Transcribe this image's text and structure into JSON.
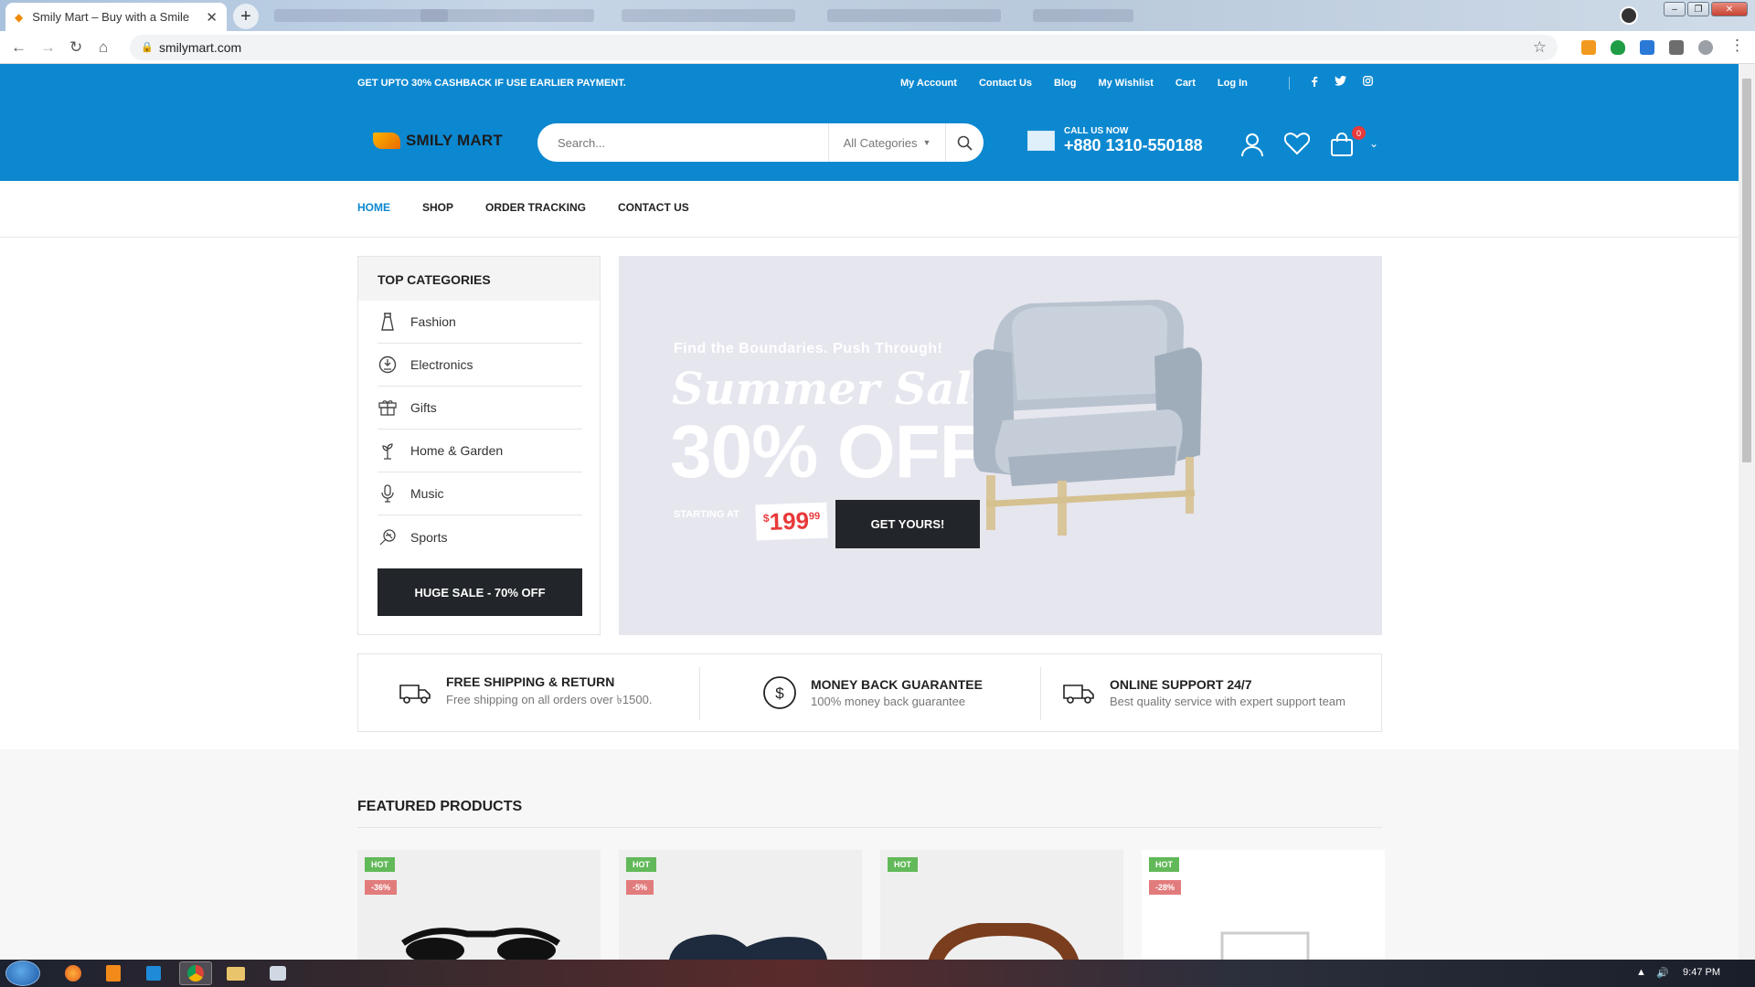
{
  "browser": {
    "tab_title": "Smily Mart – Buy with a Smile",
    "tab_close": "✕",
    "new_tab": "+",
    "url": "smilymart.com",
    "win_controls": [
      "–",
      "❐",
      "✕"
    ]
  },
  "topbar": {
    "promo": "GET UPTO 30% CASHBACK IF USE EARLIER PAYMENT.",
    "links": [
      "My Account",
      "Contact Us",
      "Blog",
      "My Wishlist",
      "Cart",
      "Log In"
    ],
    "social": [
      "f",
      "t",
      "ig"
    ]
  },
  "header": {
    "logo_text": "SMILY MART",
    "search_placeholder": "Search...",
    "category_select": "All Categories",
    "call_label": "CALL US NOW",
    "call_number": "+880 1310-550188",
    "cart_count": "0"
  },
  "nav": {
    "items": [
      "HOME",
      "SHOP",
      "ORDER TRACKING",
      "CONTACT US"
    ]
  },
  "sidebar": {
    "title": "TOP CATEGORIES",
    "items": [
      {
        "label": "Fashion",
        "icon": "dress-icon"
      },
      {
        "label": "Electronics",
        "icon": "electronics-icon"
      },
      {
        "label": "Gifts",
        "icon": "gift-icon"
      },
      {
        "label": "Home & Garden",
        "icon": "plant-icon"
      },
      {
        "label": "Music",
        "icon": "microphone-icon"
      },
      {
        "label": "Sports",
        "icon": "racket-icon"
      }
    ],
    "sale_button": "HUGE SALE - 70% OFF"
  },
  "banner": {
    "subtitle": "Find the Boundaries. Push Through!",
    "title": "Summer Sale",
    "headline": "30% OFF",
    "starting_at": "STARTING AT",
    "price_currency": "$",
    "price_main": "199",
    "price_cents": "99",
    "cta": "GET YOURS!"
  },
  "features": [
    {
      "title": "FREE SHIPPING & RETURN",
      "desc": "Free shipping on all orders over ৳1500.",
      "icon": "truck-icon"
    },
    {
      "title": "MONEY BACK GUARANTEE",
      "desc": "100% money back guarantee",
      "icon": "dollar-circle-icon"
    },
    {
      "title": "ONLINE SUPPORT 24/7",
      "desc": "Best quality service with expert support team",
      "icon": "support-truck-icon"
    }
  ],
  "featured": {
    "title": "FEATURED PRODUCTS",
    "cards": [
      {
        "hot": "HOT",
        "discount": "-36%",
        "product": "sunglasses"
      },
      {
        "hot": "HOT",
        "discount": "-5%",
        "product": "shoes"
      },
      {
        "hot": "HOT",
        "discount": "",
        "product": "belt"
      },
      {
        "hot": "HOT",
        "discount": "-28%",
        "product": "frame"
      }
    ]
  },
  "taskbar": {
    "time": "9:47 PM"
  },
  "colors": {
    "brand_blue": "#0c88d0",
    "dark": "#222529",
    "hot_green": "#62b959",
    "discount_red": "#e27c7c",
    "price_red": "#e83a3a"
  }
}
